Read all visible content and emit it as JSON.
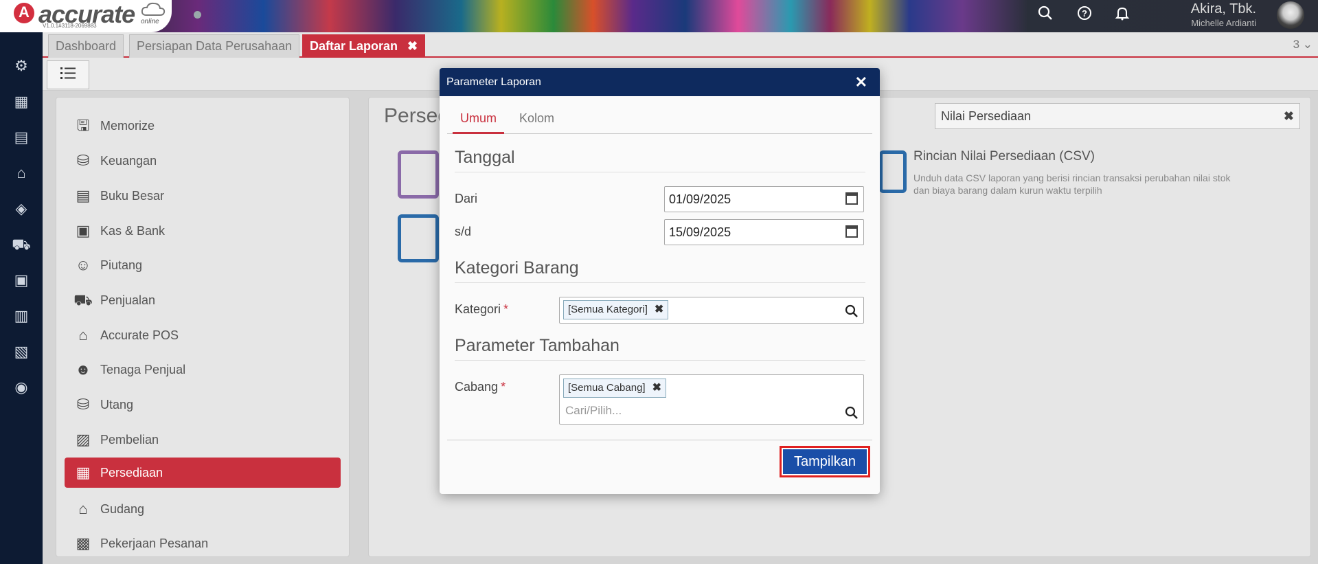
{
  "app": {
    "logo_letter": "A",
    "logo_text": "accurate",
    "logo_sub": "online",
    "version": "V1.0.1#3118-2069883"
  },
  "user": {
    "name": "Akira, Tbk.",
    "sub": "Michelle Ardianti"
  },
  "top_icons": [
    "search-icon",
    "help-icon",
    "bell-icon"
  ],
  "tabs": [
    {
      "label": "Dashboard",
      "active": false
    },
    {
      "label": "Persiapan Data Perusahaan",
      "active": false
    },
    {
      "label": "Daftar Laporan",
      "active": true
    }
  ],
  "tab_count": "3 ⌄",
  "menu": {
    "items": [
      {
        "label": "Memorize",
        "icon": "save-icon"
      },
      {
        "label": "Keuangan",
        "icon": "money-bag-icon"
      },
      {
        "label": "Buku Besar",
        "icon": "ledger-icon"
      },
      {
        "label": "Kas & Bank",
        "icon": "wallet-icon"
      },
      {
        "label": "Piutang",
        "icon": "receivable-icon"
      },
      {
        "label": "Penjualan",
        "icon": "cart-icon"
      },
      {
        "label": "Accurate POS",
        "icon": "pos-icon"
      },
      {
        "label": "Tenaga Penjual",
        "icon": "salesperson-icon"
      },
      {
        "label": "Utang",
        "icon": "payable-icon"
      },
      {
        "label": "Pembelian",
        "icon": "purchase-icon"
      },
      {
        "label": "Persediaan",
        "icon": "inventory-icon",
        "active": true
      },
      {
        "label": "Gudang",
        "icon": "warehouse-icon"
      },
      {
        "label": "Pekerjaan Pesanan",
        "icon": "job-order-icon"
      }
    ]
  },
  "right": {
    "title": "Persed",
    "search_value": "Nilai Persediaan",
    "report_title": "Rincian Nilai Persediaan (CSV)",
    "report_desc": "Unduh data CSV laporan yang berisi rincian transaksi perubahan nilai stok dan biaya barang dalam kurun waktu terpilih"
  },
  "modal": {
    "title": "Parameter Laporan",
    "tabs": [
      "Umum",
      "Kolom"
    ],
    "section_date": "Tanggal",
    "from_label": "Dari",
    "from_value": "01/09/2025",
    "to_label": "s/d",
    "to_value": "15/09/2025",
    "section_category": "Kategori Barang",
    "category_label": "Kategori",
    "category_tag": "[Semua Kategori]",
    "section_extra": "Parameter Tambahan",
    "branch_label": "Cabang",
    "branch_tag": "[Semua Cabang]",
    "branch_placeholder": "Cari/Pilih...",
    "submit_label": "Tampilkan",
    "required_mark": "*"
  },
  "colors": {
    "accent": "#c9303e",
    "navy": "#0e2a5e",
    "button": "#1a4ea8"
  }
}
